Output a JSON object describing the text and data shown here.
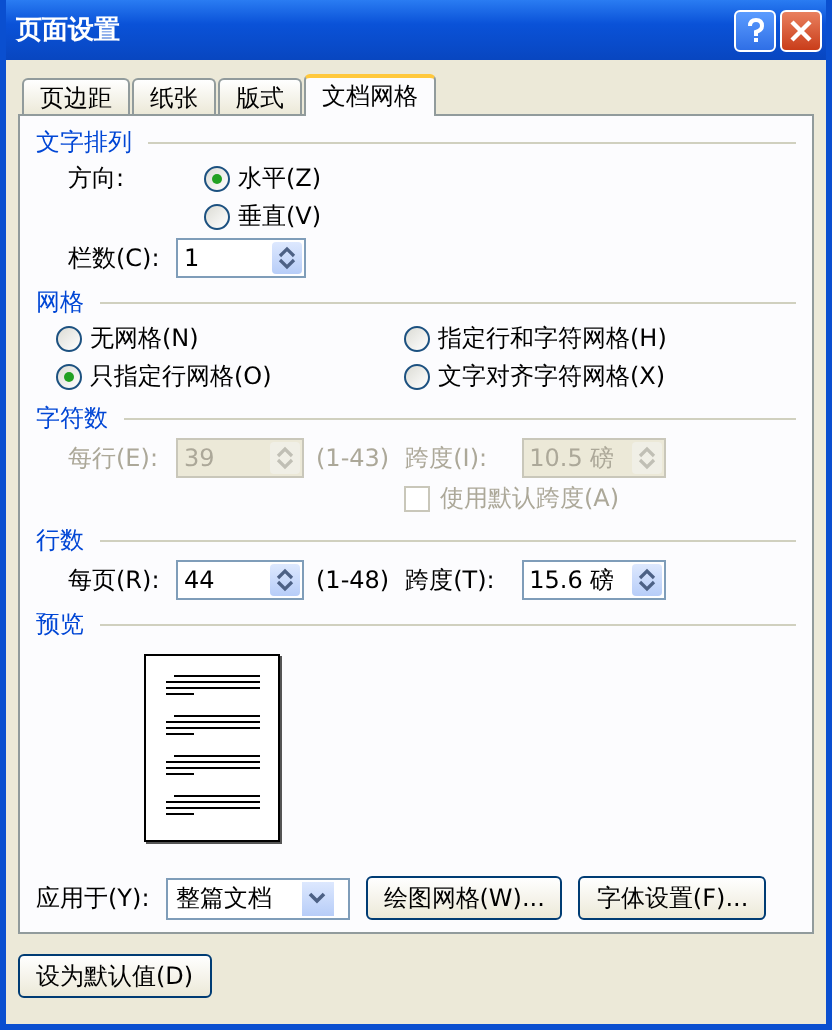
{
  "window": {
    "title": "页面设置"
  },
  "tabs": [
    {
      "label": "页边距",
      "selected": false
    },
    {
      "label": "纸张",
      "selected": false
    },
    {
      "label": "版式",
      "selected": false
    },
    {
      "label": "文档网格",
      "selected": true
    }
  ],
  "text_direction": {
    "heading": "文字排列",
    "label": "方向:",
    "options": [
      {
        "label": "水平(Z)",
        "selected": true
      },
      {
        "label": "垂直(V)",
        "selected": false
      }
    ],
    "columns": {
      "label": "栏数(C):",
      "value": "1"
    }
  },
  "grid": {
    "heading": "网格",
    "options": [
      {
        "label": "无网格(N)",
        "selected": false
      },
      {
        "label": "指定行和字符网格(H)",
        "selected": false
      },
      {
        "label": "只指定行网格(O)",
        "selected": true
      },
      {
        "label": "文字对齐字符网格(X)",
        "selected": false
      }
    ]
  },
  "characters": {
    "heading": "字符数",
    "disabled": true,
    "per_line": {
      "label": "每行(E):",
      "value": "39",
      "range": "(1-43)"
    },
    "pitch": {
      "label": "跨度(I):",
      "value": "10.5 磅"
    },
    "default_pitch": {
      "label": "使用默认跨度(A)",
      "checked": false
    }
  },
  "lines": {
    "heading": "行数",
    "disabled": false,
    "per_page": {
      "label": "每页(R):",
      "value": "44",
      "range": "(1-48)"
    },
    "pitch": {
      "label": "跨度(T):",
      "value": "15.6 磅"
    }
  },
  "preview": {
    "heading": "预览"
  },
  "apply_to": {
    "label": "应用于(Y):",
    "value": "整篇文档"
  },
  "buttons": [
    "绘图网格(W)...",
    "字体设置(F)..."
  ],
  "default_button": "设为默认值(D)"
}
